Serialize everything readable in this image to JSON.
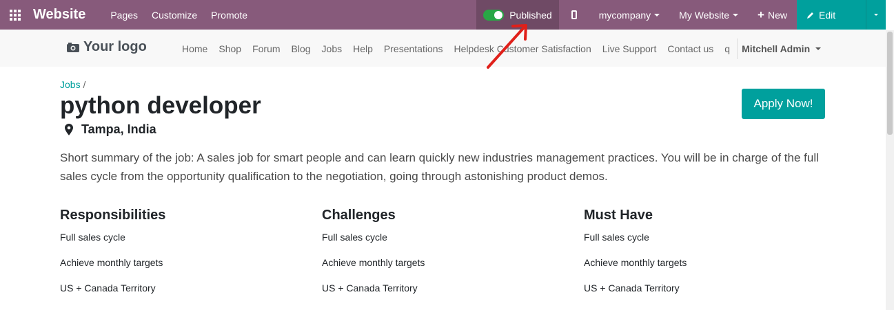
{
  "topbar": {
    "brand": "Website",
    "menu": [
      "Pages",
      "Customize",
      "Promote"
    ],
    "published_label": "Published",
    "company": "mycompany",
    "website": "My Website",
    "new_label": "New",
    "edit_label": "Edit",
    "bg_color": "#875a7b",
    "edit_color": "#00a09d"
  },
  "navbar": {
    "logo": "Your logo",
    "links": [
      "Home",
      "Shop",
      "Forum",
      "Blog",
      "Jobs",
      "Help",
      "Presentations",
      "Helpdesk Customer Satisfaction",
      "Live Support",
      "Contact us",
      "q"
    ],
    "user": "Mitchell Admin"
  },
  "job": {
    "breadcrumb": "Jobs",
    "breadcrumb_sep": "/",
    "title": "python developer",
    "location": "Tampa, India",
    "apply_label": "Apply Now!",
    "summary": "Short summary of the job: A sales job for smart people and can learn quickly new industries management practices. You will be in charge of the full sales cycle from the opportunity qualification to the negotiation, going through astonishing product demos."
  },
  "sections": [
    {
      "heading": "Responsibilities",
      "items": [
        "Full sales cycle",
        "Achieve monthly targets",
        "US + Canada Territory"
      ]
    },
    {
      "heading": "Challenges",
      "items": [
        "Full sales cycle",
        "Achieve monthly targets",
        "US + Canada Territory"
      ]
    },
    {
      "heading": "Must Have",
      "items": [
        "Full sales cycle",
        "Achieve monthly targets",
        "US + Canada Territory"
      ]
    }
  ]
}
